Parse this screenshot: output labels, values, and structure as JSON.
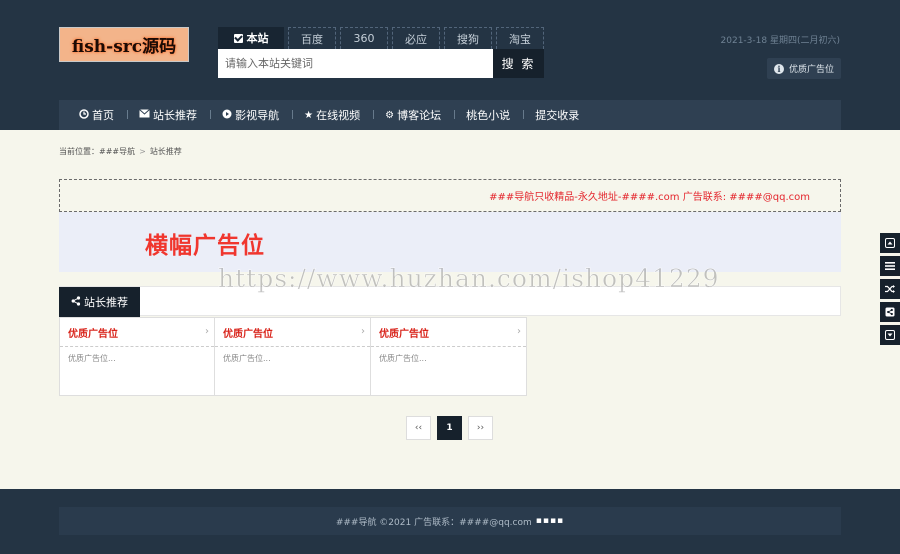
{
  "header": {
    "logo_text": "fish-src源码",
    "search": {
      "tabs": [
        "本站",
        "百度",
        "360",
        "必应",
        "搜狗",
        "淘宝"
      ],
      "placeholder": "请输入本站关键词",
      "button_label": "搜 索"
    },
    "date": "2021-3-18 星期四(二月初六)",
    "ad_button": "优质广告位"
  },
  "nav": {
    "items": [
      {
        "label": "首页",
        "icon": "clock-icon"
      },
      {
        "label": "站长推荐",
        "icon": "envelope-icon"
      },
      {
        "label": "影视导航",
        "icon": "play-circle-icon"
      },
      {
        "label": "在线视频",
        "icon": "star-icon"
      },
      {
        "label": "博客论坛",
        "icon": "gear-icon"
      },
      {
        "label": "桃色小说",
        "icon": ""
      },
      {
        "label": "提交收录",
        "icon": ""
      }
    ]
  },
  "breadcrumb": {
    "prefix": "当前位置：",
    "home": "###导航",
    "sep": ">",
    "current": "站长推荐"
  },
  "notice": "###导航只收精品-永久地址-####.com 广告联系: ####@qq.com",
  "banner": "横幅广告位",
  "watermark": "https://www.huzhan.com/ishop41229",
  "section": {
    "title": "站长推荐",
    "cards": [
      {
        "title": "优质广告位",
        "desc": "优质广告位..."
      },
      {
        "title": "优质广告位",
        "desc": "优质广告位..."
      },
      {
        "title": "优质广告位",
        "desc": "优质广告位..."
      }
    ]
  },
  "pager": {
    "prev": "‹‹",
    "current": "1",
    "next": "››"
  },
  "footer": {
    "text": "###导航 ©2021 广告联系：####@qq.com",
    "dots": "▪▪▪▪"
  },
  "side_tools": [
    "arrow-up-icon",
    "list-icon",
    "shuffle-icon",
    "share-icon",
    "arrow-down-icon"
  ]
}
